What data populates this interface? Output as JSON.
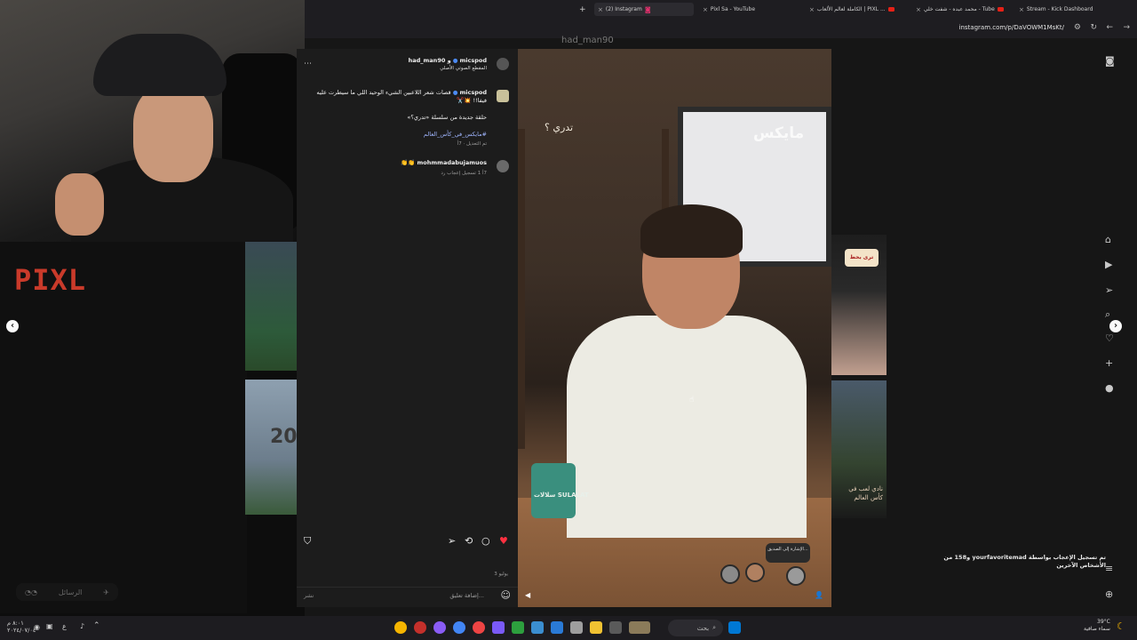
{
  "browser": {
    "tabs": [
      {
        "label": "Stream - Kick Dashboard",
        "icon": "kick-icon"
      },
      {
        "label": "محمد عبده - شفت خلي - Tube",
        "icon": "youtube-icon"
      },
      {
        "label": "الكاملة لعالم الألعاب | PIXL ...",
        "icon": "youtube-icon"
      },
      {
        "label": "Pixl Sa - YouTube",
        "icon": "youtube-icon"
      },
      {
        "label": "(2) Instagram",
        "icon": "instagram-icon",
        "active": true
      }
    ],
    "new_tab": "+",
    "url": "instagram.com/p/DaVOWM1MsKt/"
  },
  "webcam": {
    "overlay_brand": "PIXL"
  },
  "left_panel": {
    "messages_label": "الرسائل"
  },
  "post": {
    "top_username": "had_man90",
    "header_user": "micspod",
    "header_with": "و had_man90",
    "header_audio": "المقطع الصوتي الأصلي",
    "caption_user": "micspod",
    "caption_text": "قصات شعر اللاعبين الشيء الوحيد اللي ما سيطرت عليه فيفا!! 💥✂️",
    "caption_series": "حلقة جديدة من سلسلة «تدري؟»",
    "caption_hashtag": "#مايكس_في_كأس_العالم",
    "caption_meta": "تم التعديل · 7أ",
    "comment_user": "mohmmadabujamuos",
    "comment_text": "👏👏",
    "comment_meta": "7أ   1 تسجيل إعجاب   رد",
    "likes_text": "تم تسجيل الإعجاب بواسطة yourfavoritemad و158 من الأشخاص الآخرين",
    "date": "3 يوليو",
    "comment_placeholder": "إضافة تعليق...",
    "post_button": "نشر"
  },
  "video": {
    "mug_brand": "سلالات SULALAT",
    "tag_right": "مايكس",
    "tag_left": "تدري ؟",
    "mention_hint": "الإشارة إلى الصديق..."
  },
  "right_preview": {
    "tag": "ترى بحط",
    "caption": "نادي لعب في كأس العالم"
  },
  "taskbar": {
    "search_label": "بحث",
    "weather_temp": "39°C",
    "weather_desc": "سماء صافية",
    "time": "٨:٠١ م",
    "date": "٢٠٢٤/٠٧/٠٤"
  },
  "colors": {
    "accent_like": "#ff3040",
    "pixl_red": "#c93a2a",
    "hashtag_blue": "#a0b6ff",
    "mug_green": "#3a8f7e"
  }
}
